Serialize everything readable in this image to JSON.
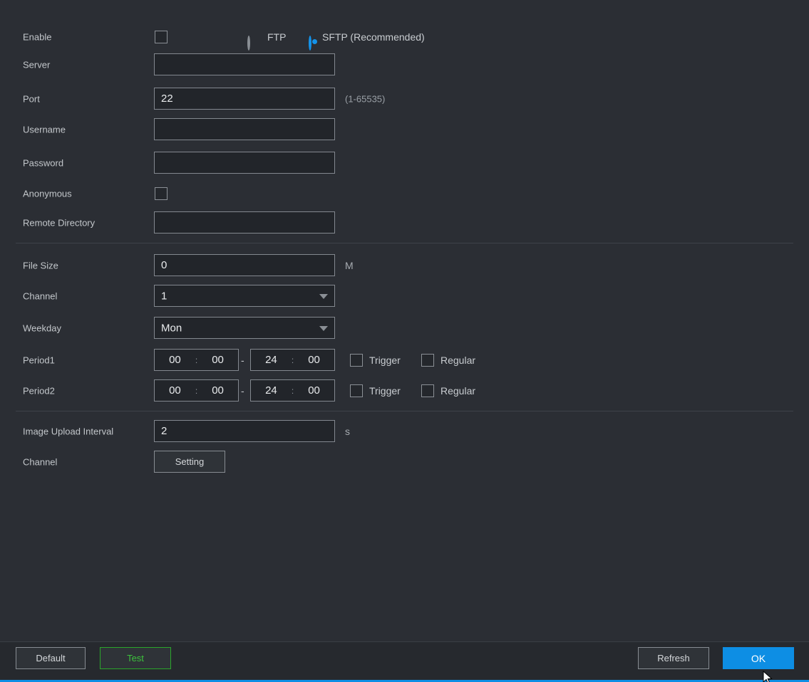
{
  "colors": {
    "accent": "#0d8ee4",
    "test_green": "#3cc23c",
    "background": "#2b2e34"
  },
  "form": {
    "enable": {
      "label": "Enable",
      "checked": false
    },
    "protocol": {
      "options": [
        {
          "label": "FTP",
          "selected": false
        },
        {
          "label": "SFTP (Recommended)",
          "selected": true
        }
      ]
    },
    "server": {
      "label": "Server",
      "value": ""
    },
    "port": {
      "label": "Port",
      "value": "22",
      "hint": "(1-65535)"
    },
    "username": {
      "label": "Username",
      "value": ""
    },
    "password": {
      "label": "Password",
      "value": ""
    },
    "anonymous": {
      "label": "Anonymous",
      "checked": false
    },
    "remote_directory": {
      "label": "Remote Directory",
      "value": ""
    },
    "file_size": {
      "label": "File Size",
      "value": "0",
      "unit": "M"
    },
    "channel": {
      "label": "Channel",
      "value": "1"
    },
    "weekday": {
      "label": "Weekday",
      "value": "Mon"
    },
    "period1": {
      "label": "Period1",
      "start_hour": "00",
      "start_min": "00",
      "end_hour": "24",
      "end_min": "00",
      "colon": ":",
      "separator": "-",
      "trigger_label": "Trigger",
      "trigger_checked": false,
      "regular_label": "Regular",
      "regular_checked": false
    },
    "period2": {
      "label": "Period2",
      "start_hour": "00",
      "start_min": "00",
      "end_hour": "24",
      "end_min": "00",
      "colon": ":",
      "separator": "-",
      "trigger_label": "Trigger",
      "trigger_checked": false,
      "regular_label": "Regular",
      "regular_checked": false
    },
    "image_upload_interval": {
      "label": "Image Upload Interval",
      "value": "2",
      "unit": "s"
    },
    "channel_setting": {
      "label": "Channel",
      "button_label": "Setting"
    }
  },
  "footer": {
    "default_label": "Default",
    "test_label": "Test",
    "refresh_label": "Refresh",
    "ok_label": "OK"
  }
}
